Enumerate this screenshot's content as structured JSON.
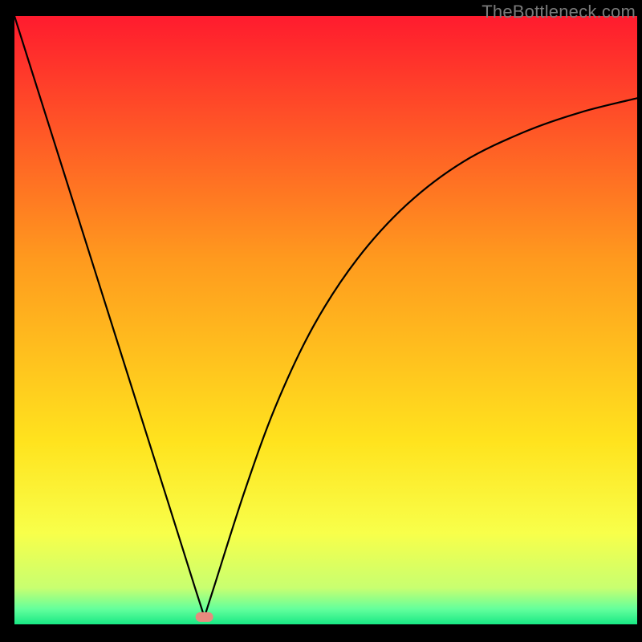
{
  "watermark": "TheBottleneck.com",
  "chart_data": {
    "type": "line",
    "title": "",
    "xlabel": "",
    "ylabel": "",
    "xlim": [
      0,
      1
    ],
    "ylim": [
      0,
      1
    ],
    "grid": false,
    "legend": false,
    "background_gradient": {
      "stops": [
        {
          "offset": 0.0,
          "color": "#ff1b2e"
        },
        {
          "offset": 0.4,
          "color": "#ff9a1e"
        },
        {
          "offset": 0.7,
          "color": "#ffe31e"
        },
        {
          "offset": 0.85,
          "color": "#f8ff4a"
        },
        {
          "offset": 0.94,
          "color": "#c8ff70"
        },
        {
          "offset": 0.975,
          "color": "#63ff9c"
        },
        {
          "offset": 1.0,
          "color": "#18e884"
        }
      ]
    },
    "curve": {
      "description": "V-shaped bottleneck curve: steep linear left branch, rounded right branch rising toward an asymptote",
      "min_x": 0.305,
      "min_y": 0.012,
      "points": [
        {
          "x": 0.0,
          "y": 1.0
        },
        {
          "x": 0.05,
          "y": 0.838
        },
        {
          "x": 0.1,
          "y": 0.676
        },
        {
          "x": 0.15,
          "y": 0.514
        },
        {
          "x": 0.2,
          "y": 0.352
        },
        {
          "x": 0.25,
          "y": 0.19
        },
        {
          "x": 0.29,
          "y": 0.06
        },
        {
          "x": 0.305,
          "y": 0.012
        },
        {
          "x": 0.32,
          "y": 0.06
        },
        {
          "x": 0.37,
          "y": 0.22
        },
        {
          "x": 0.42,
          "y": 0.36
        },
        {
          "x": 0.48,
          "y": 0.49
        },
        {
          "x": 0.55,
          "y": 0.6
        },
        {
          "x": 0.63,
          "y": 0.69
        },
        {
          "x": 0.72,
          "y": 0.76
        },
        {
          "x": 0.82,
          "y": 0.81
        },
        {
          "x": 0.91,
          "y": 0.842
        },
        {
          "x": 1.0,
          "y": 0.865
        }
      ]
    },
    "marker": {
      "x": 0.305,
      "y": 0.012,
      "color": "#e88a7e",
      "shape": "rounded-capsule"
    }
  }
}
